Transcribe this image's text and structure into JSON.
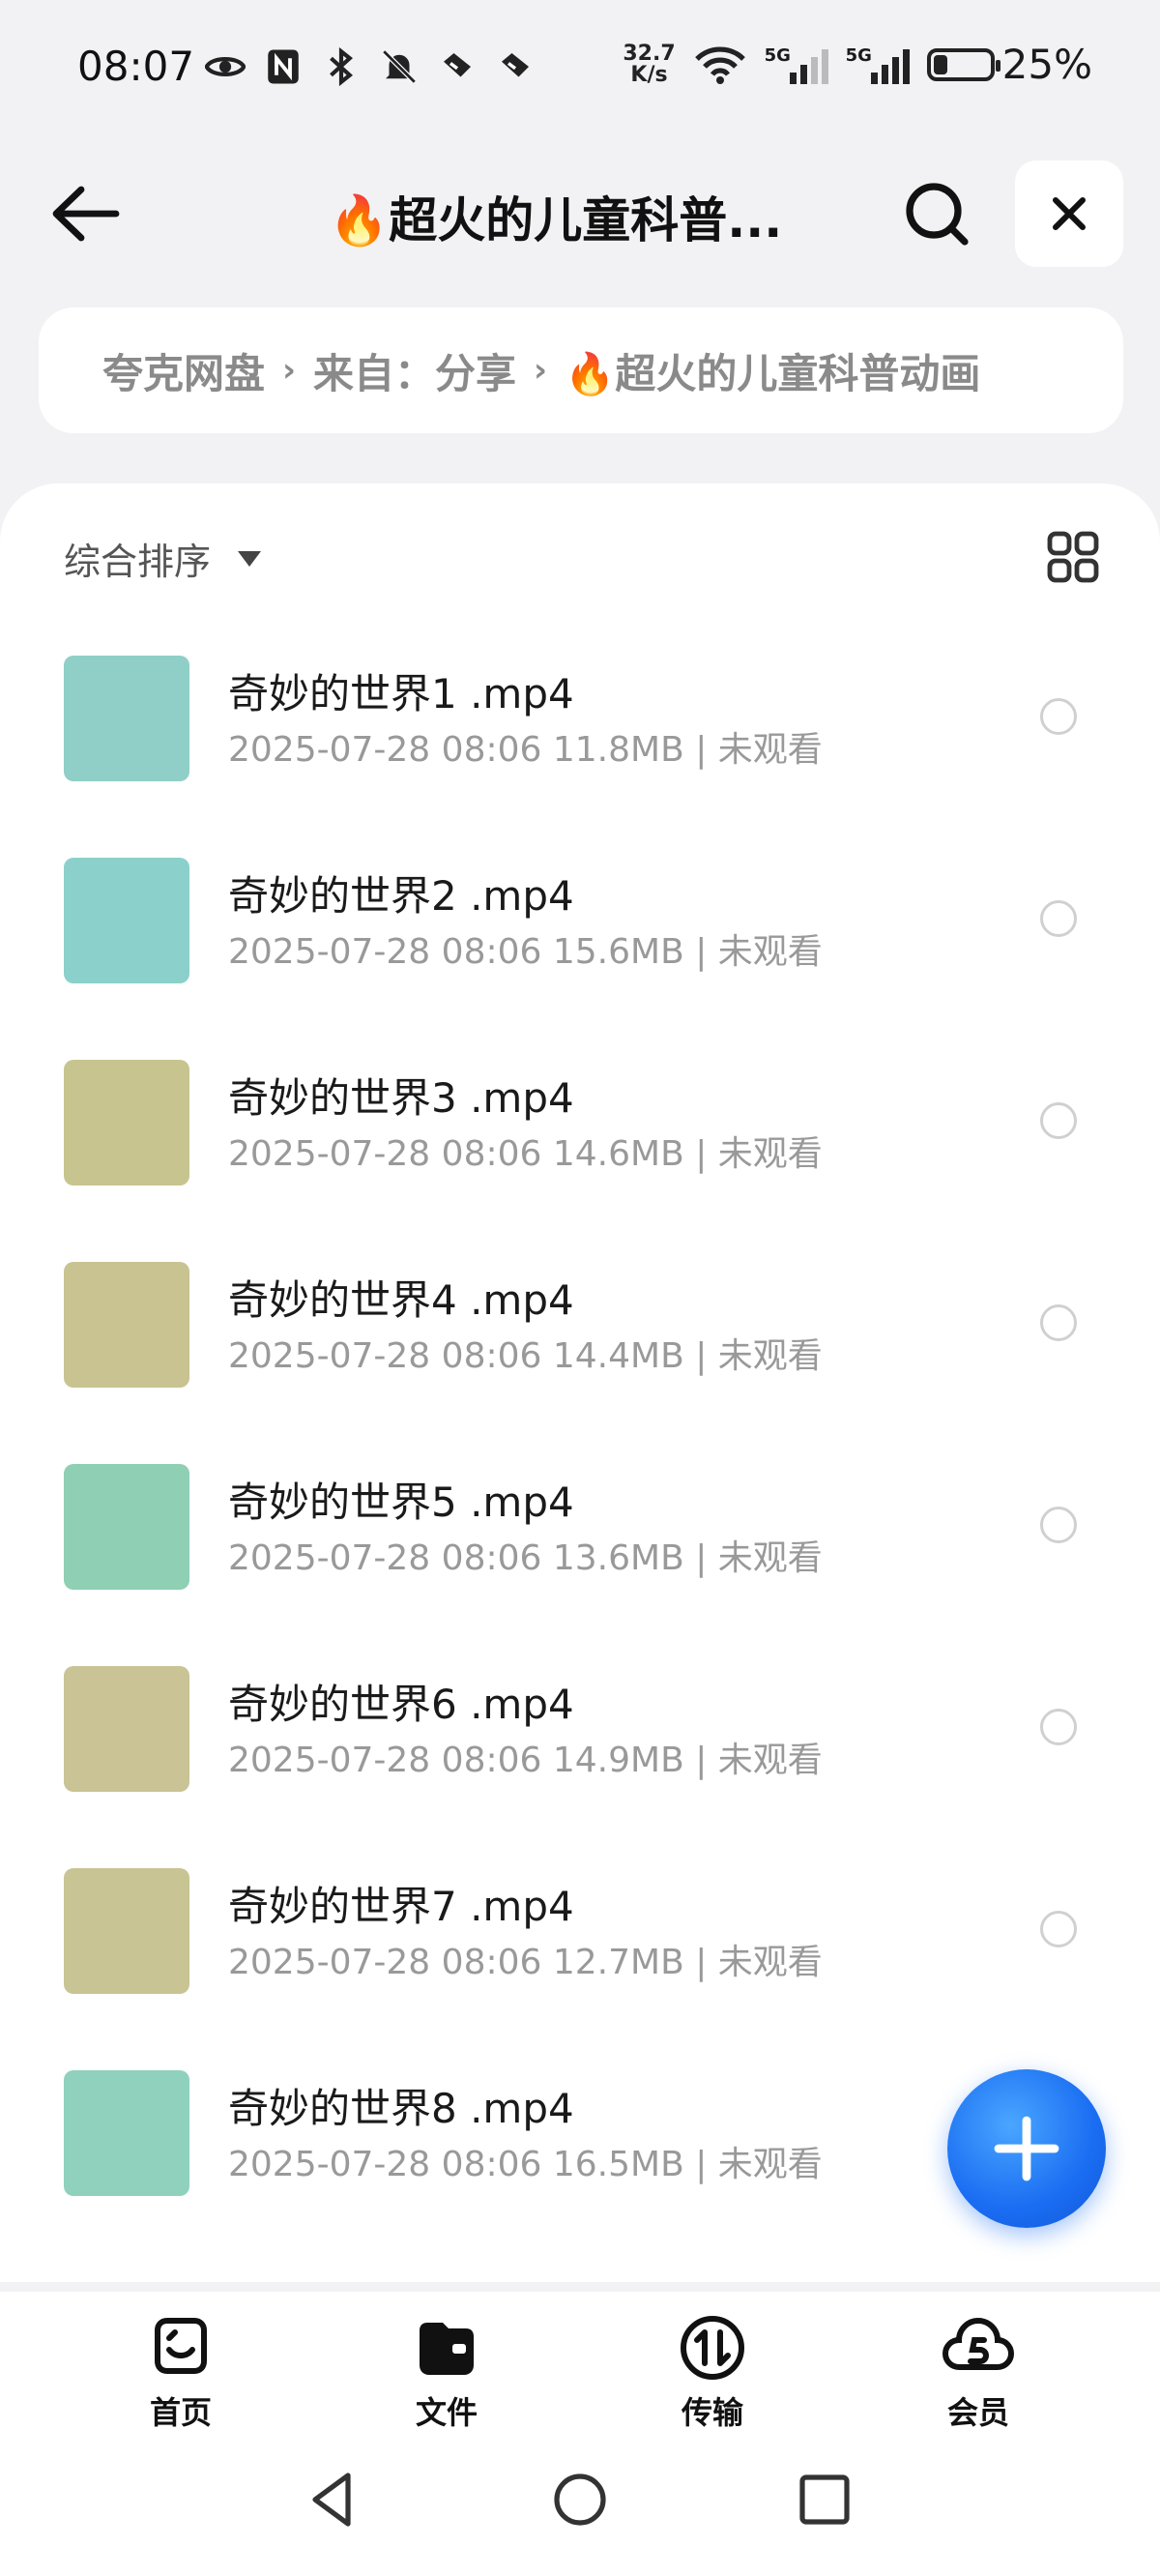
{
  "status_bar": {
    "time": "08:07",
    "net_speed_value": "32.7",
    "net_speed_unit": "K/s",
    "signal1_label": "5G",
    "signal2_label": "5G",
    "battery_percent": "25%",
    "battery_level": 0.25
  },
  "header": {
    "title": "🔥超火的儿童科普...",
    "back_icon": "arrow-left",
    "search_icon": "search",
    "close_icon": "close"
  },
  "breadcrumb": {
    "items": [
      "夸克网盘",
      "来自：分享",
      "🔥超火的儿童科普动画"
    ]
  },
  "toolbar": {
    "sort_label": "综合排序",
    "view_icon": "grid-view"
  },
  "files": [
    {
      "name": "奇妙的世界1 .mp4",
      "date": "2025-07-28 08:06",
      "size": "11.8MB",
      "status": "未观看",
      "thumb_bg": "#8fcfc7"
    },
    {
      "name": "奇妙的世界2 .mp4",
      "date": "2025-07-28 08:06",
      "size": "15.6MB",
      "status": "未观看",
      "thumb_bg": "#8bd0cb"
    },
    {
      "name": "奇妙的世界3 .mp4",
      "date": "2025-07-28 08:06",
      "size": "14.6MB",
      "status": "未观看",
      "thumb_bg": "#c7c48f"
    },
    {
      "name": "奇妙的世界4 .mp4",
      "date": "2025-07-28 08:06",
      "size": "14.4MB",
      "status": "未观看",
      "thumb_bg": "#c8c391"
    },
    {
      "name": "奇妙的世界5 .mp4",
      "date": "2025-07-28 08:06",
      "size": "13.6MB",
      "status": "未观看",
      "thumb_bg": "#8fcfb3"
    },
    {
      "name": "奇妙的世界6 .mp4",
      "date": "2025-07-28 08:06",
      "size": "14.9MB",
      "status": "未观看",
      "thumb_bg": "#c9c395"
    },
    {
      "name": "奇妙的世界7 .mp4",
      "date": "2025-07-28 08:06",
      "size": "12.7MB",
      "status": "未观看",
      "thumb_bg": "#c8c493"
    },
    {
      "name": "奇妙的世界8 .mp4",
      "date": "2025-07-28 08:06",
      "size": "16.5MB",
      "status": "未观看",
      "thumb_bg": "#8fd1bd"
    }
  ],
  "fab": {
    "icon": "plus",
    "color": "#1a6df2"
  },
  "tabs": [
    {
      "label": "首页",
      "icon": "smile-face"
    },
    {
      "label": "文件",
      "icon": "folder"
    },
    {
      "label": "传输",
      "icon": "transfer-arrows"
    },
    {
      "label": "会员",
      "icon": "cloud-s"
    }
  ],
  "nav": {
    "icons": [
      "back-triangle",
      "home-circle",
      "recents-square"
    ]
  }
}
